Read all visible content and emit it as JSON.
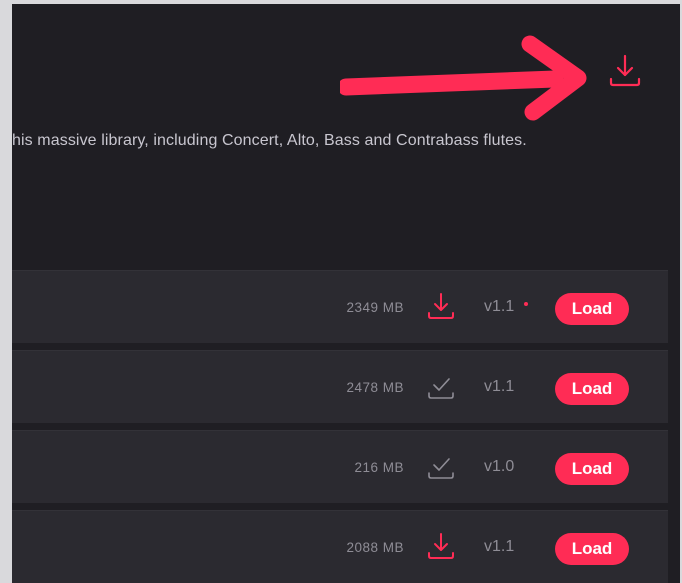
{
  "header": {
    "download_icon": "download-icon",
    "description": "his massive library, including Concert, Alto, Bass and Contrabass flutes."
  },
  "annotation": {
    "arrow_color": "#ff2c55"
  },
  "colors": {
    "accent": "#ff2c55",
    "background": "#1f1e23",
    "row_background": "#2b2a30",
    "muted_text": "#8f8d96"
  },
  "rows": [
    {
      "size": "2349 MB",
      "status_icon": "download-icon",
      "version": "v1.1",
      "update_available": true,
      "load_label": "Load"
    },
    {
      "size": "2478 MB",
      "status_icon": "installed-check-icon",
      "version": "v1.1",
      "update_available": false,
      "load_label": "Load"
    },
    {
      "size": "216 MB",
      "status_icon": "installed-check-icon",
      "version": "v1.0",
      "update_available": false,
      "load_label": "Load"
    },
    {
      "size": "2088 MB",
      "status_icon": "download-icon",
      "version": "v1.1",
      "update_available": false,
      "load_label": "Load"
    }
  ]
}
